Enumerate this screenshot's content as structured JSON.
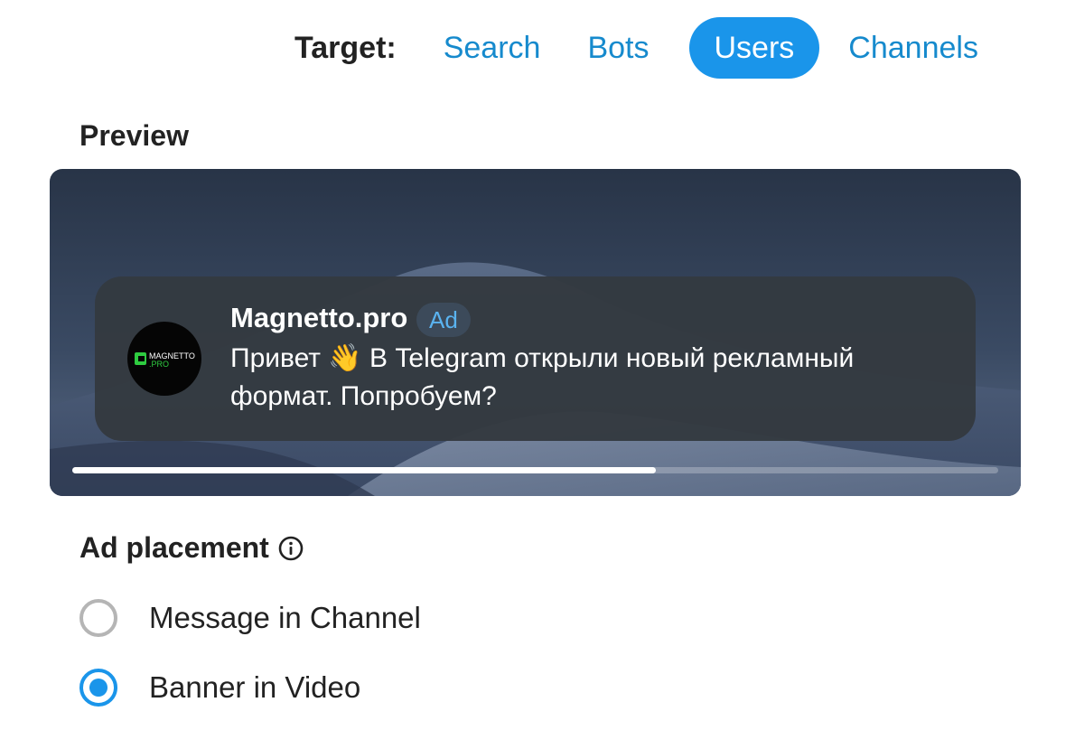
{
  "target": {
    "label": "Target:",
    "tabs": [
      {
        "label": "Search",
        "active": false
      },
      {
        "label": "Bots",
        "active": false
      },
      {
        "label": "Users",
        "active": true
      },
      {
        "label": "Channels",
        "active": false
      }
    ]
  },
  "preview": {
    "title": "Preview",
    "ad": {
      "channel_name": "Magnetto.pro",
      "badge": "Ad",
      "text": "Привет 👋 В Telegram открыли новый рекламный формат. Попробуем?",
      "avatar_logo_text": "MAGNETTO .PRO"
    },
    "progress": 0.63
  },
  "placement": {
    "title": "Ad placement",
    "info_icon": "info-icon",
    "options": [
      {
        "label": "Message in Channel",
        "selected": false
      },
      {
        "label": "Banner in Video",
        "selected": true
      }
    ]
  },
  "colors": {
    "accent": "#1a95ea",
    "link": "#168acd",
    "card_bg": "#343a40"
  }
}
